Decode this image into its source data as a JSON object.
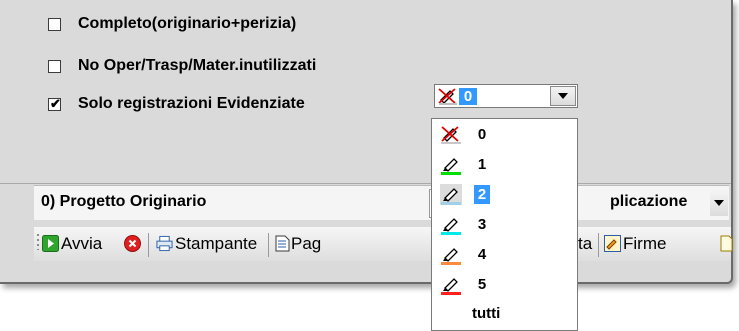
{
  "options": {
    "completo_label": "Completo(originario+perizia)",
    "no_oper_label": "No Oper/Trasp/Mater.inutilizzati",
    "solo_label": "Solo registrazioni Evidenziate",
    "checked_mark": "✔"
  },
  "highlight_combo": {
    "selected_value": "0",
    "dropdown_icon": "chevron-down-icon"
  },
  "dropdown": {
    "items": [
      {
        "label": "0",
        "icon": "crossed-highlighter-icon",
        "color": "#ff0000"
      },
      {
        "label": "1",
        "icon": "highlighter-icon",
        "color": "#00e000"
      },
      {
        "label": "2",
        "icon": "highlighter-icon",
        "color": "#9fd0e8"
      },
      {
        "label": "3",
        "icon": "highlighter-icon",
        "color": "#00e8e8"
      },
      {
        "label": "4",
        "icon": "highlighter-icon",
        "color": "#ff8a3c"
      },
      {
        "label": "5",
        "icon": "highlighter-icon",
        "color": "#ff2020"
      },
      {
        "label": "tutti",
        "icon": "",
        "color": ""
      }
    ],
    "highlighted_index": 2
  },
  "project_bar": {
    "project_label": "0) Progetto Originario",
    "right_label": "plicazione"
  },
  "toolbar": {
    "avvia_label": "Avvia",
    "stampante_label": "Stampante",
    "pag_label": "Pag",
    "ta_label": "ta",
    "firme_label": "Firme"
  },
  "colors": {
    "accent": "#3399ff",
    "panel": "#dadada"
  }
}
